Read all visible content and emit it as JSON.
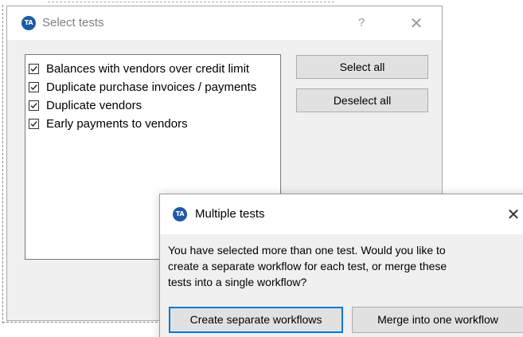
{
  "select_tests_window": {
    "logo_text": "TA",
    "title": "Select tests",
    "help_symbol": "?",
    "close_symbol": "✕",
    "tests": [
      {
        "label": "Balances with vendors over credit limit",
        "checked": true
      },
      {
        "label": "Duplicate purchase invoices / payments",
        "checked": true
      },
      {
        "label": "Duplicate vendors",
        "checked": true
      },
      {
        "label": "Early payments to vendors",
        "checked": true
      }
    ],
    "select_all_label": "Select all",
    "deselect_all_label": "Deselect all"
  },
  "multiple_tests_dialog": {
    "logo_text": "TA",
    "title": "Multiple tests",
    "close_symbol": "✕",
    "message_lines": [
      "You have selected more than one test. Would you like to",
      "create a separate workflow for each test, or merge these",
      "tests into a single workflow?"
    ],
    "create_separate_label": "Create separate workflows",
    "merge_label": "Merge into one workflow"
  },
  "colors": {
    "logo": "#1f5aa6",
    "window_bg": "#f0f0f0",
    "button_bg": "#e1e1e1",
    "default_button_border": "#0078d7"
  },
  "icons": {
    "logo": "ta-logo-icon",
    "help": "help-icon",
    "close": "close-icon",
    "checkbox": "checkmark-icon"
  }
}
